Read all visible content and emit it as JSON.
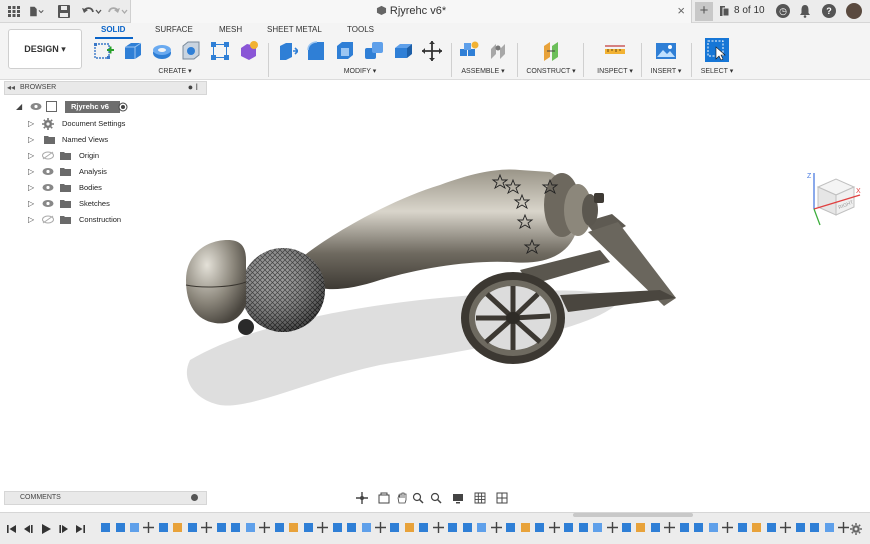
{
  "window": {
    "document_title": "Rjyrehc v6*",
    "version_count": "8 of 10",
    "help_icon": "?",
    "accent_color": "#0a64c8"
  },
  "toolbar": {
    "workspace_label": "DESIGN ▾",
    "tabs": [
      "SOLID",
      "SURFACE",
      "MESH",
      "SHEET METAL",
      "TOOLS"
    ],
    "active_tab": "SOLID",
    "groups": [
      "CREATE ▾",
      "MODIFY ▾",
      "ASSEMBLE ▾",
      "CONSTRUCT ▾",
      "INSPECT ▾",
      "INSERT ▾",
      "SELECT ▾"
    ]
  },
  "browser": {
    "title": "BROWSER",
    "root_label": "Rjyrehc v6",
    "items": [
      {
        "label": "Document Settings",
        "icon": "gear-icon"
      },
      {
        "label": "Named Views",
        "icon": "folder-icon"
      },
      {
        "label": "Origin",
        "icon": "folder-icon"
      },
      {
        "label": "Analysis",
        "icon": "folder-icon"
      },
      {
        "label": "Bodies",
        "icon": "folder-icon"
      },
      {
        "label": "Sketches",
        "icon": "folder-icon"
      },
      {
        "label": "Construction",
        "icon": "folder-icon"
      }
    ]
  },
  "viewcube": {
    "face_label": "RIGHT",
    "axis_x": "X",
    "axis_z": "Z"
  },
  "comments": {
    "title": "COMMENTS"
  },
  "navbar": {
    "icons": [
      "orbit-icon",
      "capture-icon",
      "pan-icon",
      "zoom-window-icon",
      "zoom-icon",
      "display-settings-icon",
      "grid-icon",
      "viewports-icon"
    ]
  },
  "timeline": {
    "controls": [
      "skip-start-icon",
      "step-back-icon",
      "play-icon",
      "step-forward-icon",
      "skip-end-icon"
    ],
    "feature_count": 52
  }
}
